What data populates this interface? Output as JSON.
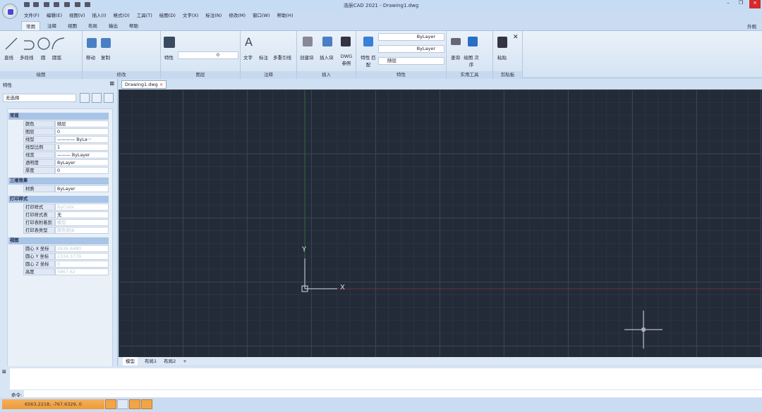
{
  "window": {
    "title": "浩辰CAD 2021 - Drawing1.dwg",
    "minimize": "–",
    "restore": "❐",
    "close": "×"
  },
  "menu": [
    "文件(F)",
    "编辑(E)",
    "视图(V)",
    "插入(I)",
    "格式(O)",
    "工具(T)",
    "绘图(D)",
    "文字(X)",
    "标注(N)",
    "修改(M)",
    "窗口(W)",
    "帮助(H)"
  ],
  "tabs": [
    "常用",
    "注释",
    "视图",
    "布局",
    "输出",
    "帮助"
  ],
  "appearance": "外观",
  "ribbon": {
    "draw": {
      "label": "绘图",
      "tools": [
        "直线",
        "多段线",
        "圆",
        "圆弧"
      ]
    },
    "modify": {
      "label": "修改",
      "tools": [
        "移动",
        "复制"
      ]
    },
    "layers": {
      "label": "图层",
      "tools": [
        "特性"
      ],
      "layer_value": "0"
    },
    "annotation": {
      "label": "注释",
      "tools": [
        "文字",
        "标注",
        "多重引线"
      ]
    },
    "insert": {
      "label": "插入",
      "tools": [
        "创建块",
        "插入块",
        "DWG 参照"
      ]
    },
    "properties": {
      "label": "特性",
      "match": "特性 匹配",
      "linetype": "ByLayer",
      "lineweight": "ByLayer",
      "color": "随层"
    },
    "utilities": {
      "label": "实用工具",
      "tools": [
        "查询",
        "绘图 次序"
      ]
    },
    "clipboard": {
      "label": "剪贴板",
      "tools": [
        "粘贴"
      ]
    }
  },
  "doc_tab": "Drawing1.dwg",
  "properties_panel": {
    "title": "特性",
    "selection": "无选择",
    "sections": [
      {
        "title": "常规",
        "rows": [
          [
            "颜色",
            "随层"
          ],
          [
            "图层",
            "0"
          ],
          [
            "线型",
            "———— ByLa···"
          ],
          [
            "线型比例",
            "1"
          ],
          [
            "线宽",
            "——— ByLayer"
          ],
          [
            "透明度",
            "ByLayer"
          ],
          [
            "厚度",
            "0"
          ]
        ]
      },
      {
        "title": "三维效果",
        "rows": [
          [
            "材质",
            "ByLayer"
          ]
        ]
      },
      {
        "title": "打印样式",
        "rows": [
          [
            "打印样式",
            "ByColor"
          ],
          [
            "打印样式表",
            "无"
          ],
          [
            "打印表附着到",
            "模型"
          ],
          [
            "打印表类型",
            "颜色相关"
          ]
        ]
      },
      {
        "title": "视图",
        "rows": [
          [
            "圆心 X 坐标",
            "2636.6480"
          ],
          [
            "圆心 Y 坐标",
            "1334.3779"
          ],
          [
            "圆心 Z 坐标",
            "0"
          ],
          [
            "高度",
            "5867.62"
          ]
        ]
      }
    ]
  },
  "canvas": {
    "axis_x": "X",
    "axis_y": "Y",
    "background": "#232b39"
  },
  "layout_tabs": [
    "模型",
    "布局1",
    "布局2",
    "+"
  ],
  "command": {
    "label": "命令:",
    "input": ""
  },
  "status": {
    "coordinates": "6563.2218, -767.6329, 0"
  }
}
